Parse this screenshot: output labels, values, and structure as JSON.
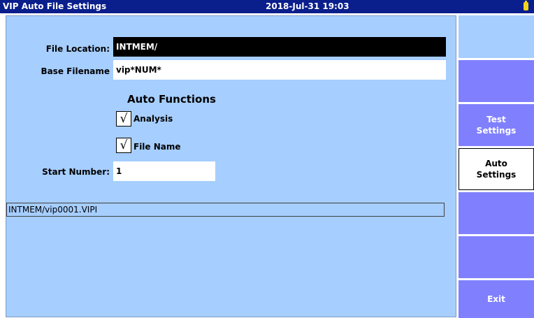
{
  "titlebar": {
    "title": "VIP Auto File Settings",
    "datetime": "2018-Jul-31 19:03"
  },
  "form": {
    "file_location_label": "File Location:",
    "file_location_value": "INTMEM/",
    "base_filename_label": "Base Filename",
    "base_filename_value": "vip*NUM*",
    "auto_functions_heading": "Auto Functions",
    "analysis_label": "Analysis",
    "analysis_checked": true,
    "file_name_label": "File Name",
    "file_name_checked": true,
    "start_number_label": "Start Number:",
    "start_number_value": "1",
    "check_glyph": "√"
  },
  "preview_path": "INTMEM/vip0001.VIPI",
  "sidebar": {
    "buttons": [
      "",
      "",
      "Test\nSettings",
      "Auto\nSettings",
      "",
      "",
      "Exit"
    ]
  }
}
